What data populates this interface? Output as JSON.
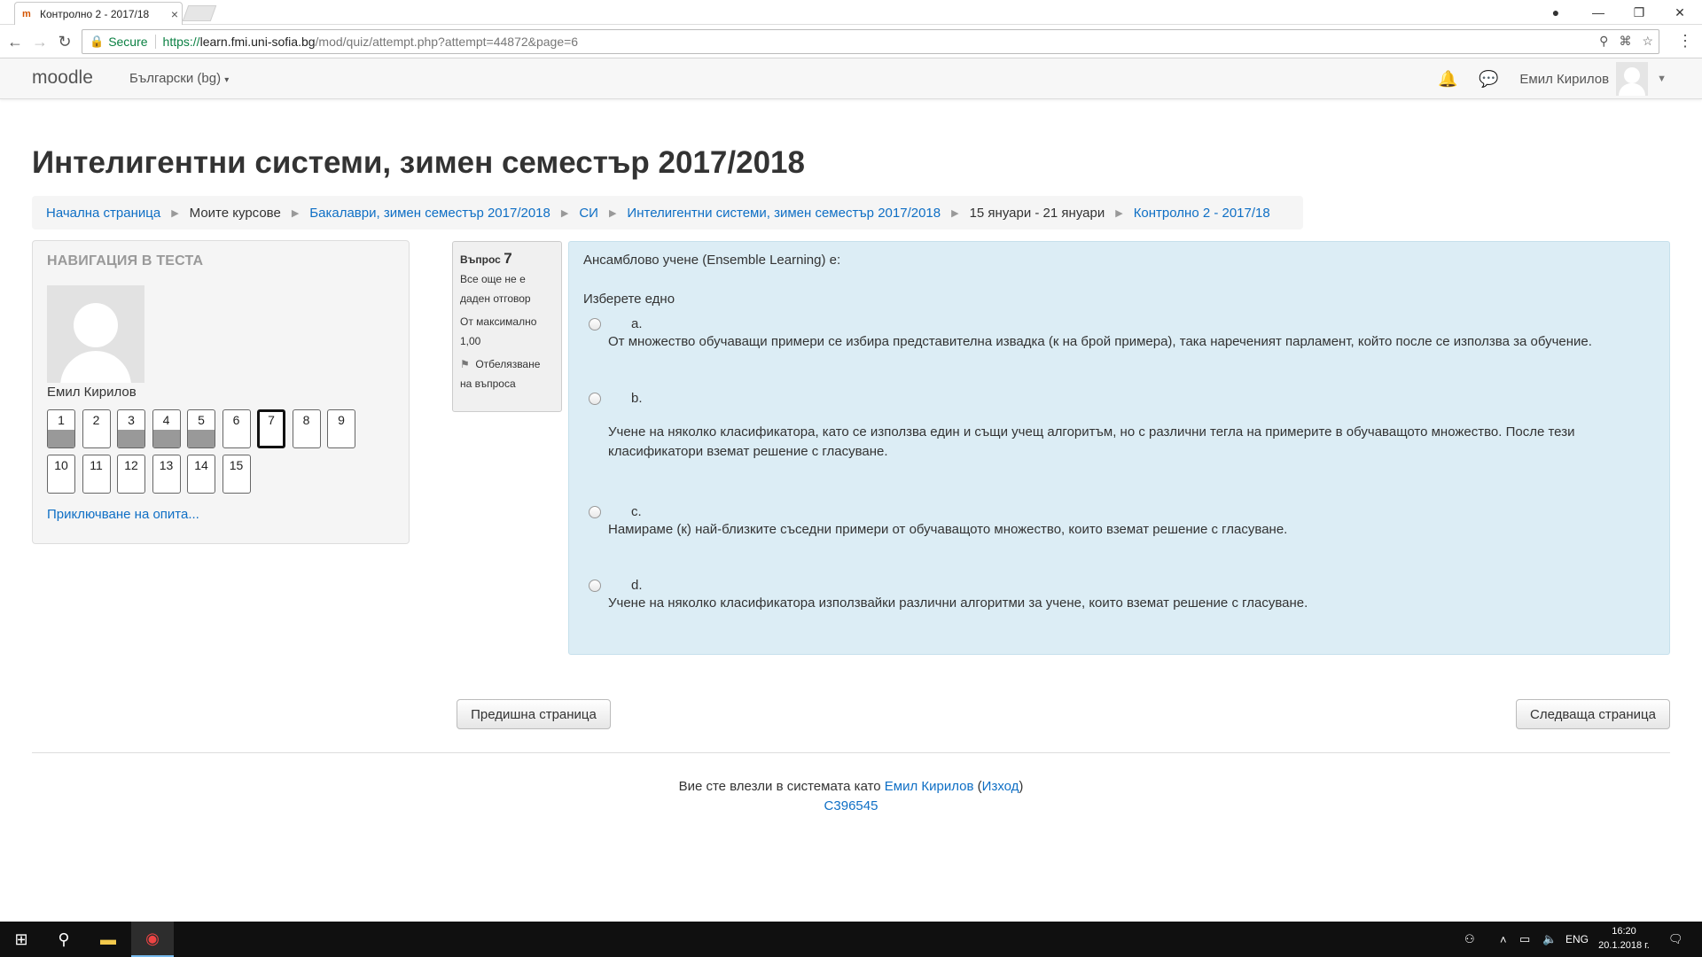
{
  "browser": {
    "tab_title": "Контролно 2 - 2017/18",
    "secure_label": "Secure",
    "url_scheme": "https://",
    "url_host": "learn.fmi.uni-sofia.bg",
    "url_path": "/mod/quiz/attempt.php?attempt=44872&page=6"
  },
  "navbar": {
    "brand": "moodle",
    "language": "Български (bg)",
    "user_name": "Емил Кирилов"
  },
  "page": {
    "title": "Интелигентни системи, зимен семестър 2017/2018"
  },
  "breadcrumb": [
    {
      "label": "Начална страница",
      "link": true
    },
    {
      "label": "Моите курсове",
      "link": false
    },
    {
      "label": "Бакалаври, зимен семестър 2017/2018",
      "link": true
    },
    {
      "label": "СИ",
      "link": true
    },
    {
      "label": "Интелигентни системи, зимен семестър 2017/2018",
      "link": true
    },
    {
      "label": "15 януари - 21 януари",
      "link": false
    },
    {
      "label": "Контролно 2 - 2017/18",
      "link": true
    }
  ],
  "quiz_nav": {
    "title": "НАВИГАЦИЯ В ТЕСТА",
    "user_name": "Емил Кирилов",
    "questions": [
      {
        "label": "1",
        "answered": true
      },
      {
        "label": "2",
        "answered": false
      },
      {
        "label": "3",
        "answered": true
      },
      {
        "label": "4",
        "answered": true
      },
      {
        "label": "5",
        "answered": true
      },
      {
        "label": "6",
        "answered": false
      },
      {
        "label": "7",
        "answered": false,
        "current": true
      },
      {
        "label": "8",
        "answered": false
      },
      {
        "label": "9",
        "answered": false
      },
      {
        "label": "10",
        "answered": false
      },
      {
        "label": "11",
        "answered": false
      },
      {
        "label": "12",
        "answered": false
      },
      {
        "label": "13",
        "answered": false
      },
      {
        "label": "14",
        "answered": false
      },
      {
        "label": "15",
        "answered": false
      }
    ],
    "finish_link": "Приключване на опита..."
  },
  "question_info": {
    "label": "Въпрос",
    "number": "7",
    "state_line1": "Все още не е",
    "state_line2": "даден отговор",
    "grade_line1": "От максимално",
    "grade_line2": "1,00",
    "flag_line1": "Отбелязване",
    "flag_line2": "на въпроса"
  },
  "question": {
    "text": "Ансамблово учене (Ensemble Learning) е:",
    "prompt": "Изберете едно",
    "options": [
      {
        "letter": "a.",
        "text": "От множество обучаващи примери се избира представителна извадка (к на брой примера), така нареченият парламент, който после се използва за обучение."
      },
      {
        "letter": "b.",
        "text": "Учене на няколко класификатора, като се използва един и същи учещ алгоритъм, но с различни тегла на примерите в обучаващото множество. После тези класификатори вземат решение с гласуване."
      },
      {
        "letter": "c.",
        "text": "Намираме (к) най-близките съседни примери от обучаващото множество, които вземат решение с гласуване."
      },
      {
        "letter": "d.",
        "text": "Учене на няколко класификатора използвайки различни алгоритми за учене, които вземат решение с гласуване."
      }
    ]
  },
  "buttons": {
    "previous": "Предишна страница",
    "next": "Следваща страница"
  },
  "footer": {
    "logged_in_text": "Вие сте влезли в системата като",
    "user_name": "Емил Кирилов",
    "paren_open": "(",
    "logout": "Изход",
    "paren_close": ")",
    "code": "C396545"
  },
  "taskbar": {
    "language": "ENG",
    "time": "16:20",
    "date": "20.1.2018 г."
  }
}
